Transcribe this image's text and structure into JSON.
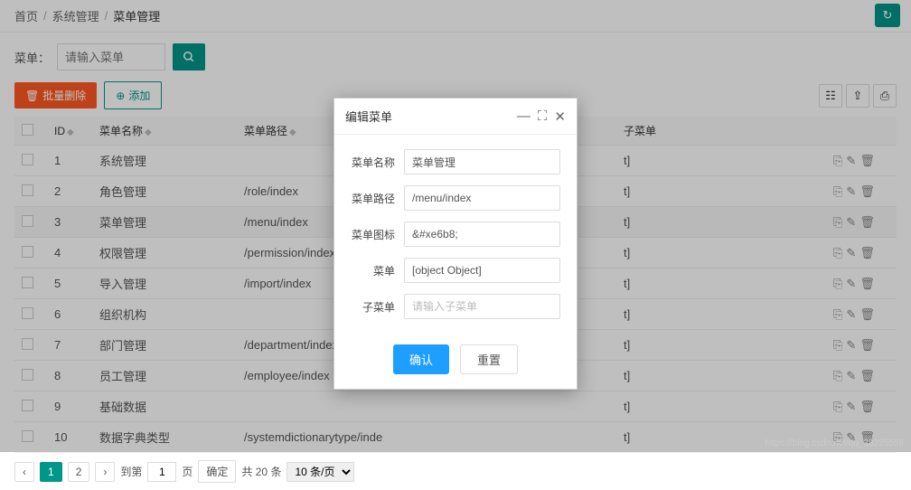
{
  "breadcrumb": {
    "home": "首页",
    "section": "系统管理",
    "current": "菜单管理"
  },
  "search": {
    "label": "菜单：",
    "placeholder": "请输入菜单"
  },
  "toolbar": {
    "batch_delete": "批量删除",
    "add": "添加"
  },
  "table": {
    "cols": {
      "id": "ID",
      "name": "菜单名称",
      "path": "菜单路径",
      "submenu": "子菜单"
    },
    "rows": [
      {
        "id": "1",
        "name": "系统管理",
        "path": ""
      },
      {
        "id": "2",
        "name": "角色管理",
        "path": "/role/index"
      },
      {
        "id": "3",
        "name": "菜单管理",
        "path": "/menu/index"
      },
      {
        "id": "4",
        "name": "权限管理",
        "path": "/permission/index"
      },
      {
        "id": "5",
        "name": "导入管理",
        "path": "/import/index"
      },
      {
        "id": "6",
        "name": "组织机构",
        "path": ""
      },
      {
        "id": "7",
        "name": "部门管理",
        "path": "/department/index"
      },
      {
        "id": "8",
        "name": "员工管理",
        "path": "/employee/index"
      },
      {
        "id": "9",
        "name": "基础数据",
        "path": ""
      },
      {
        "id": "10",
        "name": "数据字典类型",
        "path": "/systemdictionarytype/inde"
      }
    ]
  },
  "pagination": {
    "page1": "1",
    "page2": "2",
    "goto_label": "到第",
    "page_val": "1",
    "page_unit": "页",
    "confirm": "确定",
    "total": "共 20 条",
    "per_page": "10 条/页"
  },
  "dialog": {
    "title": "编辑菜单",
    "fields": {
      "name": {
        "label": "菜单名称",
        "value": "菜单管理"
      },
      "path": {
        "label": "菜单路径",
        "value": "/menu/index"
      },
      "icon": {
        "label": "菜单图标",
        "value": "&#xe6b8;"
      },
      "menu": {
        "label": "菜单",
        "value": "[object Object]"
      },
      "submenu": {
        "label": "子菜单",
        "placeholder": "请输入子菜单"
      }
    },
    "ok": "确认",
    "reset": "重置"
  },
  "watermark": "https://blog.csdn.net/qq_38225558"
}
